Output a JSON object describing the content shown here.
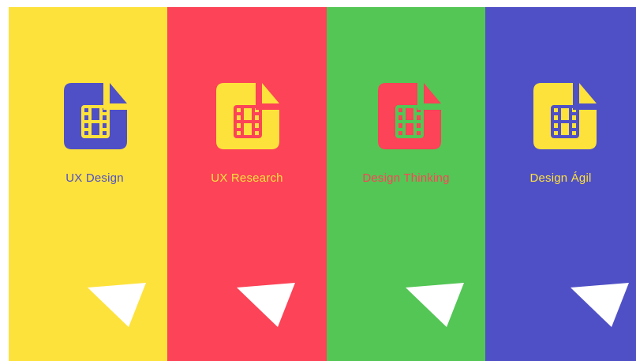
{
  "colors": {
    "yellow": "#fde23c",
    "red": "#fc4357",
    "green": "#53c655",
    "blue": "#5050c6",
    "white": "#ffffff"
  },
  "panels": [
    {
      "label": "UX Design",
      "bg": "#fde23c",
      "icon_color": "#5050c6",
      "label_color": "#5050c6",
      "icon": "video-file-icon",
      "action_icon": "cursor-arrow-icon"
    },
    {
      "label": "UX Research",
      "bg": "#fc4357",
      "icon_color": "#fde23c",
      "label_color": "#fde23c",
      "icon": "video-file-icon",
      "action_icon": "cursor-arrow-icon"
    },
    {
      "label": "Design Thinking",
      "bg": "#53c655",
      "icon_color": "#fc4357",
      "label_color": "#fc4357",
      "icon": "video-file-icon",
      "action_icon": "cursor-arrow-icon"
    },
    {
      "label": "Design Ágil",
      "bg": "#5050c6",
      "icon_color": "#fde23c",
      "label_color": "#fde23c",
      "icon": "video-file-icon",
      "action_icon": "cursor-arrow-icon"
    }
  ]
}
